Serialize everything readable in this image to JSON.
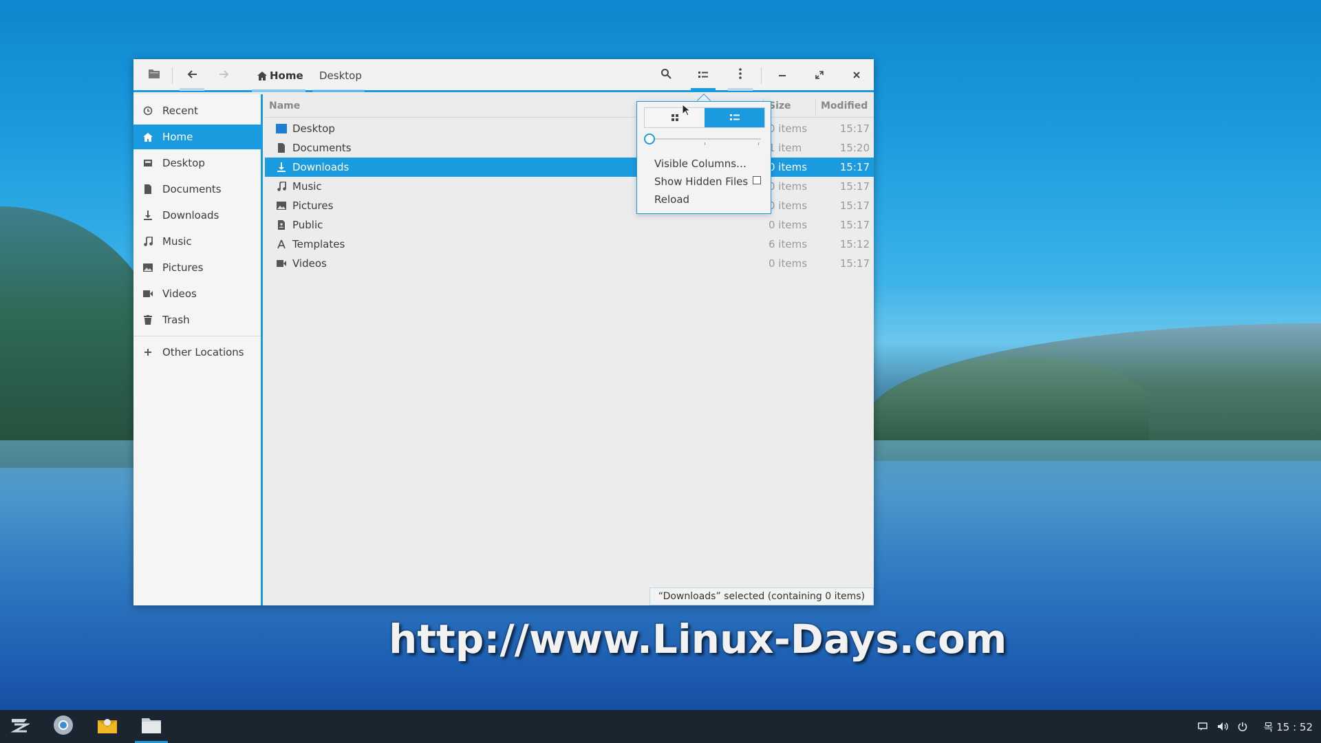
{
  "watermark": "http://www.Linux-Days.com",
  "headerbar": {
    "breadcrumbs": [
      "Home",
      "Desktop"
    ]
  },
  "sidebar": {
    "items": [
      {
        "label": "Recent",
        "icon": "clock-icon"
      },
      {
        "label": "Home",
        "icon": "home-icon",
        "selected": true
      },
      {
        "label": "Desktop",
        "icon": "desktop-icon"
      },
      {
        "label": "Documents",
        "icon": "document-icon"
      },
      {
        "label": "Downloads",
        "icon": "download-icon"
      },
      {
        "label": "Music",
        "icon": "music-icon"
      },
      {
        "label": "Pictures",
        "icon": "picture-icon"
      },
      {
        "label": "Videos",
        "icon": "video-icon"
      },
      {
        "label": "Trash",
        "icon": "trash-icon"
      }
    ],
    "other_locations": "Other Locations"
  },
  "columns": {
    "name": "Name",
    "size": "Size",
    "modified": "Modified"
  },
  "files": [
    {
      "name": "Desktop",
      "size": "0 items",
      "modified": "15:17",
      "icon": "desktop-folder-icon"
    },
    {
      "name": "Documents",
      "size": "1 item",
      "modified": "15:20",
      "icon": "document-folder-icon"
    },
    {
      "name": "Downloads",
      "size": "0 items",
      "modified": "15:17",
      "icon": "download-folder-icon",
      "selected": true
    },
    {
      "name": "Music",
      "size": "0 items",
      "modified": "15:17",
      "icon": "music-folder-icon"
    },
    {
      "name": "Pictures",
      "size": "0 items",
      "modified": "15:17",
      "icon": "picture-folder-icon"
    },
    {
      "name": "Public",
      "size": "0 items",
      "modified": "15:17",
      "icon": "public-folder-icon"
    },
    {
      "name": "Templates",
      "size": "6 items",
      "modified": "15:12",
      "icon": "templates-folder-icon"
    },
    {
      "name": "Videos",
      "size": "0 items",
      "modified": "15:17",
      "icon": "video-folder-icon"
    }
  ],
  "status": "“Downloads” selected (containing 0 items)",
  "popover": {
    "visible_columns": "Visible Columns…",
    "show_hidden": "Show Hidden Files",
    "show_hidden_checked": false,
    "reload": "Reload",
    "zoom_level": 0
  },
  "tray": {
    "clock": "목 15 : 52"
  },
  "colors": {
    "accent": "#1a9be0",
    "taskbar": "#1b2530"
  }
}
